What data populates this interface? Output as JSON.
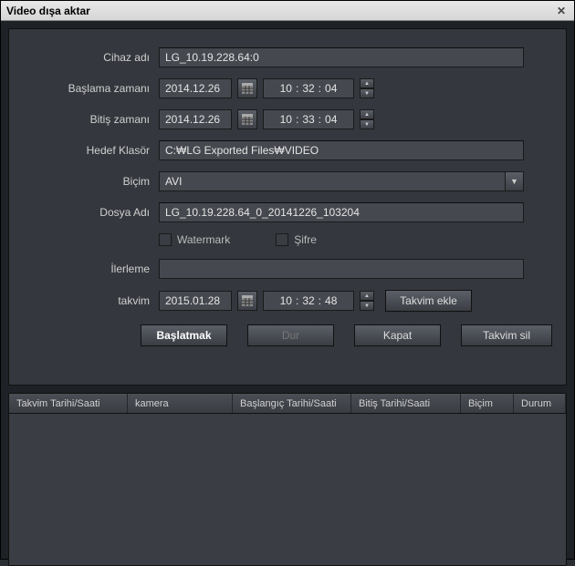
{
  "window": {
    "title": "Video dışa aktar"
  },
  "labels": {
    "device": "Cihaz adı",
    "start": "Başlama zamanı",
    "end": "Bitiş zamanı",
    "target": "Hedef Klasör",
    "format": "Biçim",
    "filename": "Dosya Adı",
    "progress": "İlerleme",
    "schedule": "takvim"
  },
  "values": {
    "device": "LG_10.19.228.64:0",
    "startDate": "2014.12.26",
    "startH": "10",
    "startM": "32",
    "startS": "04",
    "endDate": "2014.12.26",
    "endH": "10",
    "endM": "33",
    "endS": "04",
    "target": "C:₩LG Exported Files₩VIDEO",
    "format": "AVI",
    "filename": "LG_10.19.228.64_0_20141226_103204",
    "schedDate": "2015.01.28",
    "schedH": "10",
    "schedM": "32",
    "schedS": "48"
  },
  "checks": {
    "watermark": "Watermark",
    "password": "Şifre"
  },
  "buttons": {
    "addSched": "Takvim ekle",
    "start": "Başlatmak",
    "stop": "Dur",
    "close": "Kapat",
    "delSched": "Takvim sil"
  },
  "colSep": ":",
  "table": {
    "cols": {
      "c1": "Takvim Tarihi/Saati",
      "c2": "kamera",
      "c3": "Başlangıç Tarihi/Saati",
      "c4": "Bitiş Tarihi/Saati",
      "c5": "Biçim",
      "c6": "Durum"
    }
  }
}
